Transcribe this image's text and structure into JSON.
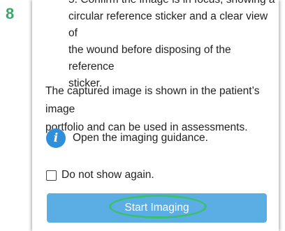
{
  "step": {
    "number": "8"
  },
  "instructions": {
    "list_item_number": "5.",
    "list_item_text_line1": "Confirm the image is in focus, showing a",
    "list_item_text_line2": "circular reference sticker and a clear view of",
    "list_item_text_line3": "the wound before disposing of the reference",
    "list_item_text_line4": "sticker."
  },
  "description": {
    "line1": "The captured image is shown in the patient’s image",
    "line2": "portfolio and can be used in assessments."
  },
  "guidance": {
    "icon": "info-icon",
    "icon_glyph": "i",
    "label": "Open the imaging guidance."
  },
  "checkbox": {
    "label": "Do not show again.",
    "checked": false
  },
  "primary_button": {
    "label": "Start Imaging"
  },
  "colors": {
    "step_number": "#3aa76d",
    "info_icon": "#2f8fd8",
    "button": "#5aaee4",
    "highlight": "#3dbf72"
  }
}
